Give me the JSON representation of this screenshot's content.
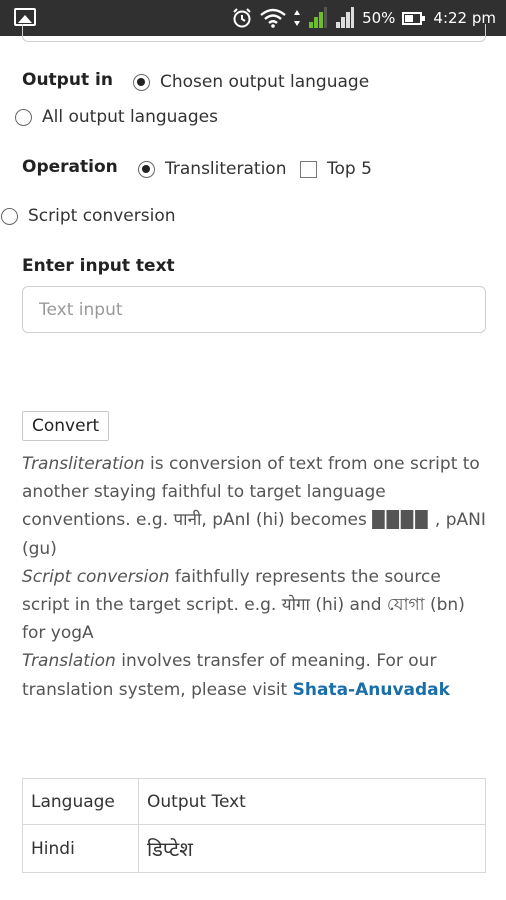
{
  "status_bar": {
    "battery_percent": "50%",
    "time": "4:22 pm",
    "icons": [
      "gallery-icon",
      "alarm-icon",
      "wifi-icon",
      "signal-icon",
      "battery-icon"
    ]
  },
  "output_in": {
    "label": "Output in",
    "options": [
      {
        "label": "Chosen output language",
        "checked": true
      },
      {
        "label": "All output languages",
        "checked": false
      }
    ]
  },
  "operation": {
    "label": "Operation",
    "transliteration_label": "Transliteration",
    "top5_label": "Top 5",
    "script_conversion_label": "Script conversion"
  },
  "input": {
    "label": "Enter input text",
    "placeholder": "Text input",
    "value": ""
  },
  "convert_button": "Convert",
  "info": {
    "p1_term": "Transliteration",
    "p1_text": " is conversion of text from one script to another staying faithful to target language conventions. e.g. पानी, pAnI (hi) becomes ",
    "p1_blocks": "████",
    "p1_tail": " , pANI (gu)",
    "p2_term": "Script conversion",
    "p2_text": " faithfully represents the source script in the target script. e.g. योगा (hi) and যোগা (bn) for yogA",
    "p3_term": "Translation",
    "p3_text": " involves transfer of meaning. For our translation system, please visit ",
    "p3_link": "Shata-Anuvadak"
  },
  "result_table": {
    "headers": [
      "Language",
      "Output Text"
    ],
    "rows": [
      [
        "Hindi",
        "डिप्टेश"
      ]
    ]
  },
  "colors": {
    "status_bar": "#303030",
    "link": "#1b6fa8"
  }
}
